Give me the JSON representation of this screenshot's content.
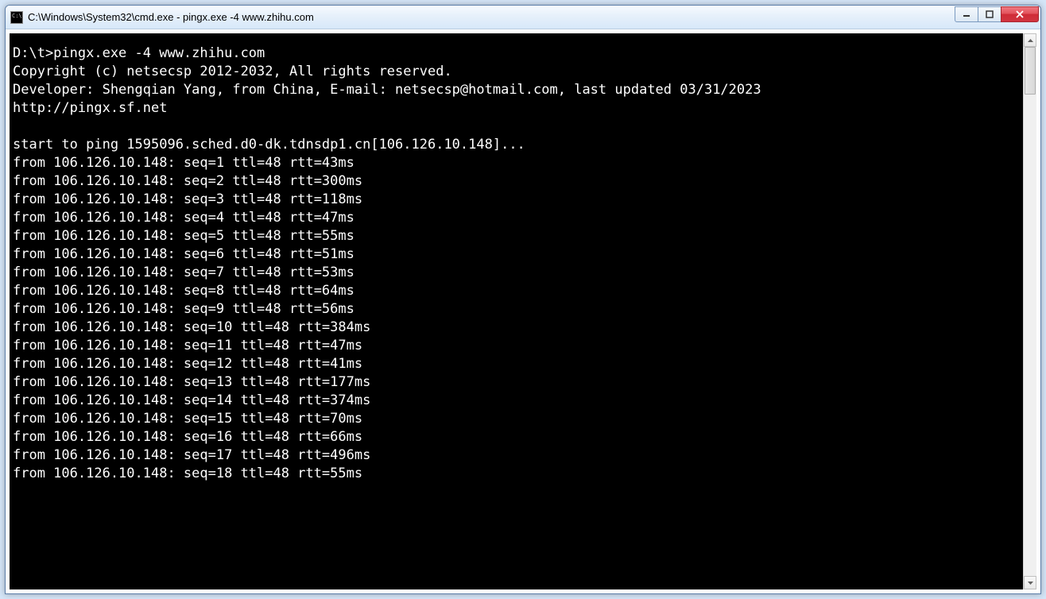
{
  "window": {
    "title": "C:\\Windows\\System32\\cmd.exe - pingx.exe  -4 www.zhihu.com"
  },
  "terminal": {
    "prompt": "D:\\t>",
    "command": "pingx.exe -4 www.zhihu.com",
    "copyright": "Copyright (c) netsecsp 2012-2032, All rights reserved.",
    "developer": "Developer: Shengqian Yang, from China, E-mail: netsecsp@hotmail.com, last updated 03/31/2023",
    "url": "http://pingx.sf.net",
    "start": "start to ping 1595096.sched.d0-dk.tdnsdp1.cn[106.126.10.148]...",
    "from_ip": "106.126.10.148",
    "ttl": 48,
    "replies": [
      {
        "seq": 1,
        "rtt": 43
      },
      {
        "seq": 2,
        "rtt": 300
      },
      {
        "seq": 3,
        "rtt": 118
      },
      {
        "seq": 4,
        "rtt": 47
      },
      {
        "seq": 5,
        "rtt": 55
      },
      {
        "seq": 6,
        "rtt": 51
      },
      {
        "seq": 7,
        "rtt": 53
      },
      {
        "seq": 8,
        "rtt": 64
      },
      {
        "seq": 9,
        "rtt": 56
      },
      {
        "seq": 10,
        "rtt": 384
      },
      {
        "seq": 11,
        "rtt": 47
      },
      {
        "seq": 12,
        "rtt": 41
      },
      {
        "seq": 13,
        "rtt": 177
      },
      {
        "seq": 14,
        "rtt": 374
      },
      {
        "seq": 15,
        "rtt": 70
      },
      {
        "seq": 16,
        "rtt": 66
      },
      {
        "seq": 17,
        "rtt": 496
      },
      {
        "seq": 18,
        "rtt": 55
      }
    ]
  }
}
